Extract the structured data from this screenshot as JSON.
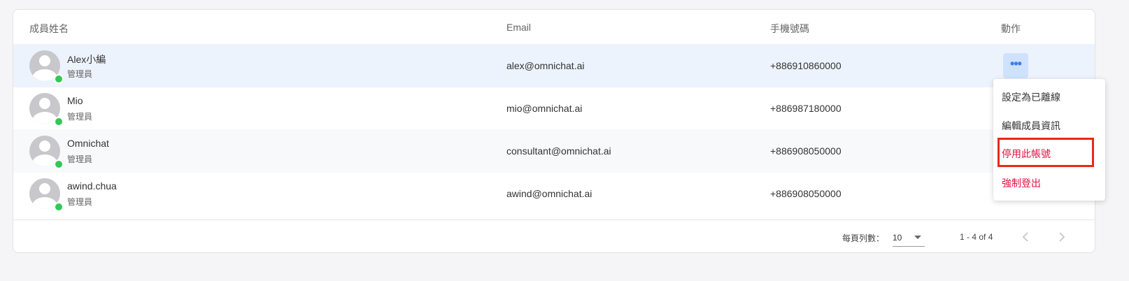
{
  "table": {
    "headers": {
      "name": "成員姓名",
      "email": "Email",
      "phone": "手機號碼",
      "actions": "動作"
    },
    "rows": [
      {
        "name": "Alex小編",
        "role": "管理員",
        "email": "alex@omnichat.ai",
        "phone": "+886910860000"
      },
      {
        "name": "Mio",
        "role": "管理員",
        "email": "mio@omnichat.ai",
        "phone": "+886987180000"
      },
      {
        "name": "Omnichat",
        "role": "管理員",
        "email": "consultant@omnichat.ai",
        "phone": "+886908050000"
      },
      {
        "name": "awind.chua",
        "role": "管理員",
        "email": "awind@omnichat.ai",
        "phone": "+886908050000"
      }
    ],
    "more_label": "•••"
  },
  "action_menu": {
    "items": [
      {
        "label": "設定為已離線",
        "style": "normal"
      },
      {
        "label": "編輯成員資訊",
        "style": "normal"
      },
      {
        "label": "停用此帳號",
        "style": "danger"
      },
      {
        "label": "強制登出",
        "style": "danger"
      }
    ]
  },
  "pagination": {
    "rows_per_page_label": "每頁列數：",
    "rows_per_page_value": "10",
    "range_label": "1 - 4 of 4"
  },
  "colors": {
    "accent": "#3b7ef0",
    "danger": "#e0103f",
    "online": "#35c759",
    "selected_row": "#edf3fc",
    "highlight_box": "#e8291a"
  }
}
